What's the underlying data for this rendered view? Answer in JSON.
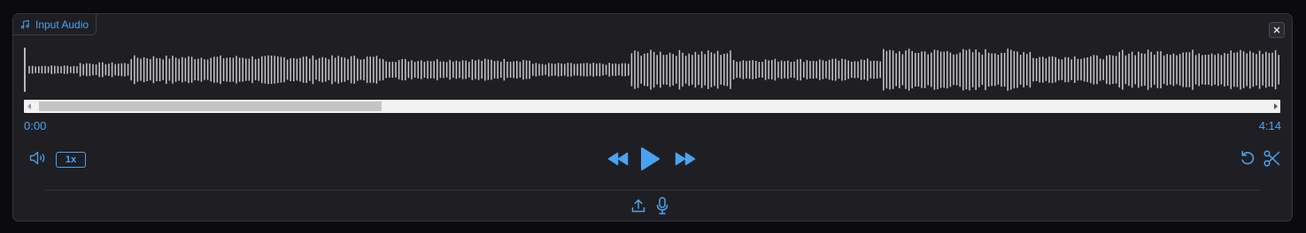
{
  "panel": {
    "title": "Input Audio",
    "title_icon": "music-note-icon",
    "close_icon": "close-icon"
  },
  "waveform": {
    "color": "#c8c8cc",
    "cursor_color": "#e0e0e0"
  },
  "timeline": {
    "current_time": "0:00",
    "duration": "4:14"
  },
  "controls": {
    "volume_icon": "volume-icon",
    "speed_label": "1x",
    "rewind_icon": "rewind-icon",
    "play_icon": "play-icon",
    "fast_forward_icon": "fast-forward-icon",
    "reset_icon": "undo-icon",
    "trim_icon": "scissors-icon"
  },
  "footer": {
    "upload_icon": "upload-icon",
    "microphone_icon": "microphone-icon"
  },
  "colors": {
    "accent": "#4aa3f0",
    "panel_bg": "#1f1f23",
    "page_bg": "#0b0b0f"
  }
}
